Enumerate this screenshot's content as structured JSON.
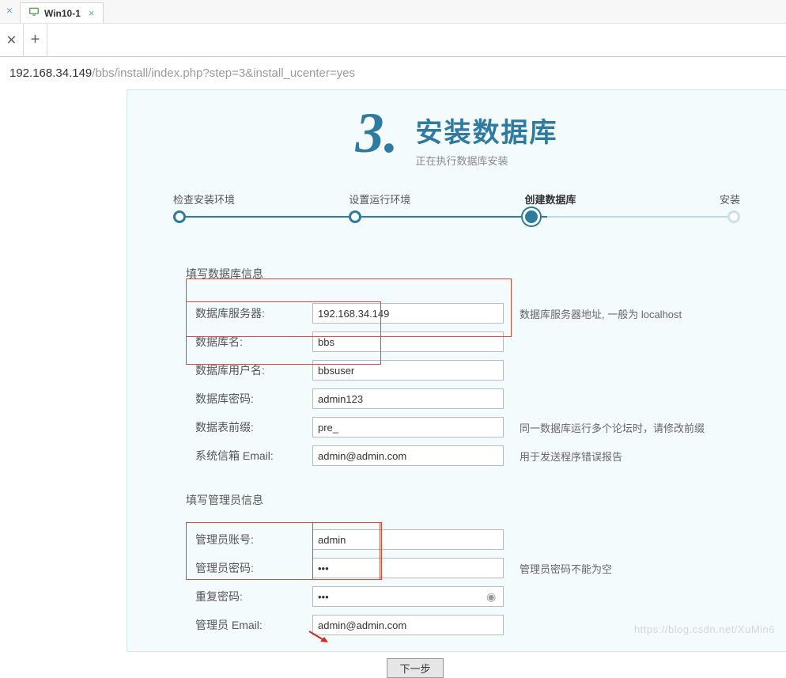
{
  "ide": {
    "tab_title": "Win10-1"
  },
  "addr": {
    "host": "192.168.34.149",
    "path": "/bbs/install/index.php?step=3&install_ucenter=yes"
  },
  "heading": {
    "num": "3.",
    "title": "安装数据库",
    "sub": "正在执行数据库安装"
  },
  "steps": {
    "s1": "检查安装环境",
    "s2": "设置运行环境",
    "s3": "创建数据库",
    "s4": "安装"
  },
  "sections": {
    "db": "填写数据库信息",
    "admin": "填写管理员信息"
  },
  "db": {
    "server_l": "数据库服务器:",
    "server_v": "192.168.34.149",
    "server_h": "数据库服务器地址, 一般为 localhost",
    "name_l": "数据库名:",
    "name_v": "bbs",
    "user_l": "数据库用户名:",
    "user_v": "bbsuser",
    "pass_l": "数据库密码:",
    "pass_v": "admin123",
    "prefix_l": "数据表前缀:",
    "prefix_v": "pre_",
    "prefix_h": "同一数据库运行多个论坛时，请修改前缀",
    "mail_l": "系统信箱 Email:",
    "mail_v": "admin@admin.com",
    "mail_h": "用于发送程序错误报告"
  },
  "admin": {
    "acc_l": "管理员账号:",
    "acc_v": "admin",
    "pw_l": "管理员密码:",
    "pw_v": "•••",
    "pw_h": "管理员密码不能为空",
    "rpw_l": "重复密码:",
    "rpw_v": "•••",
    "mail_l": "管理员 Email:",
    "mail_v": "admin@admin.com"
  },
  "next_label": "下一步",
  "watermark": "https://blog.csdn.net/XuMin6"
}
